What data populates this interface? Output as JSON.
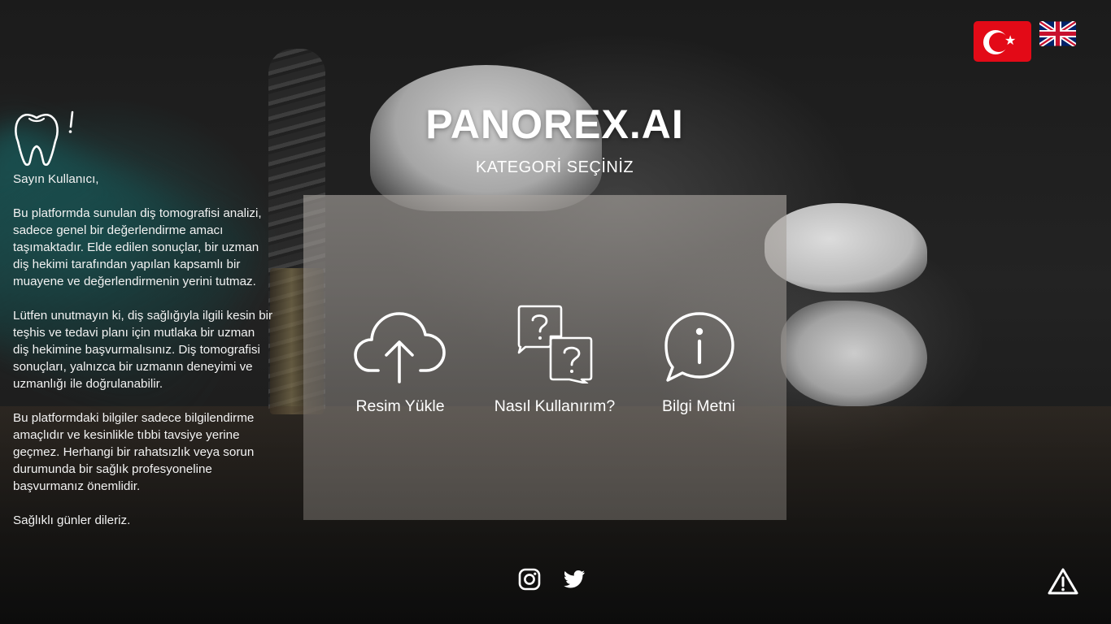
{
  "header": {
    "brand": "PANOREX.AI",
    "subtitle": "KATEGORİ SEÇİNİZ"
  },
  "languages": [
    {
      "code": "tr",
      "icon": "turkey-flag-icon",
      "active": true
    },
    {
      "code": "en",
      "icon": "uk-flag-icon",
      "active": false
    }
  ],
  "disclaimer": {
    "icon": "tooth-alert-icon",
    "paragraphs": [
      "Sayın Kullanıcı,",
      "Bu platformda sunulan diş tomografisi analizi, sadece genel bir değerlendirme amacı taşımaktadır. Elde edilen sonuçlar, bir uzman diş hekimi tarafından yapılan kapsamlı bir muayene ve değerlendirmenin yerini tutmaz.",
      "Lütfen unutmayın ki, diş sağlığıyla ilgili kesin bir teşhis ve tedavi planı için mutlaka bir uzman diş hekimine başvurmalısınız. Diş tomografisi sonuçları, yalnızca bir uzmanın deneyimi ve uzmanlığı ile doğrulanabilir.",
      "Bu platformdaki bilgiler sadece bilgilendirme amaçlıdır ve kesinlikle tıbbi tavsiye yerine geçmez. Herhangi bir rahatsızlık veya sorun durumunda bir sağlık profesyoneline başvurmanız önemlidir.",
      "Sağlıklı günler dileriz."
    ]
  },
  "categories": [
    {
      "label": "Resim Yükle",
      "icon": "cloud-upload-icon"
    },
    {
      "label": "Nasıl Kullanırım?",
      "icon": "question-bubbles-icon"
    },
    {
      "label": "Bilgi Metni",
      "icon": "info-bubble-icon"
    }
  ],
  "footer": {
    "social": [
      {
        "name": "Instagram",
        "icon": "instagram-icon"
      },
      {
        "name": "Twitter",
        "icon": "twitter-icon"
      }
    ],
    "warning_icon": "warning-icon"
  },
  "colors": {
    "flag_red": "#e30a17",
    "text": "#ffffff",
    "panel": "#a9a5a0"
  }
}
